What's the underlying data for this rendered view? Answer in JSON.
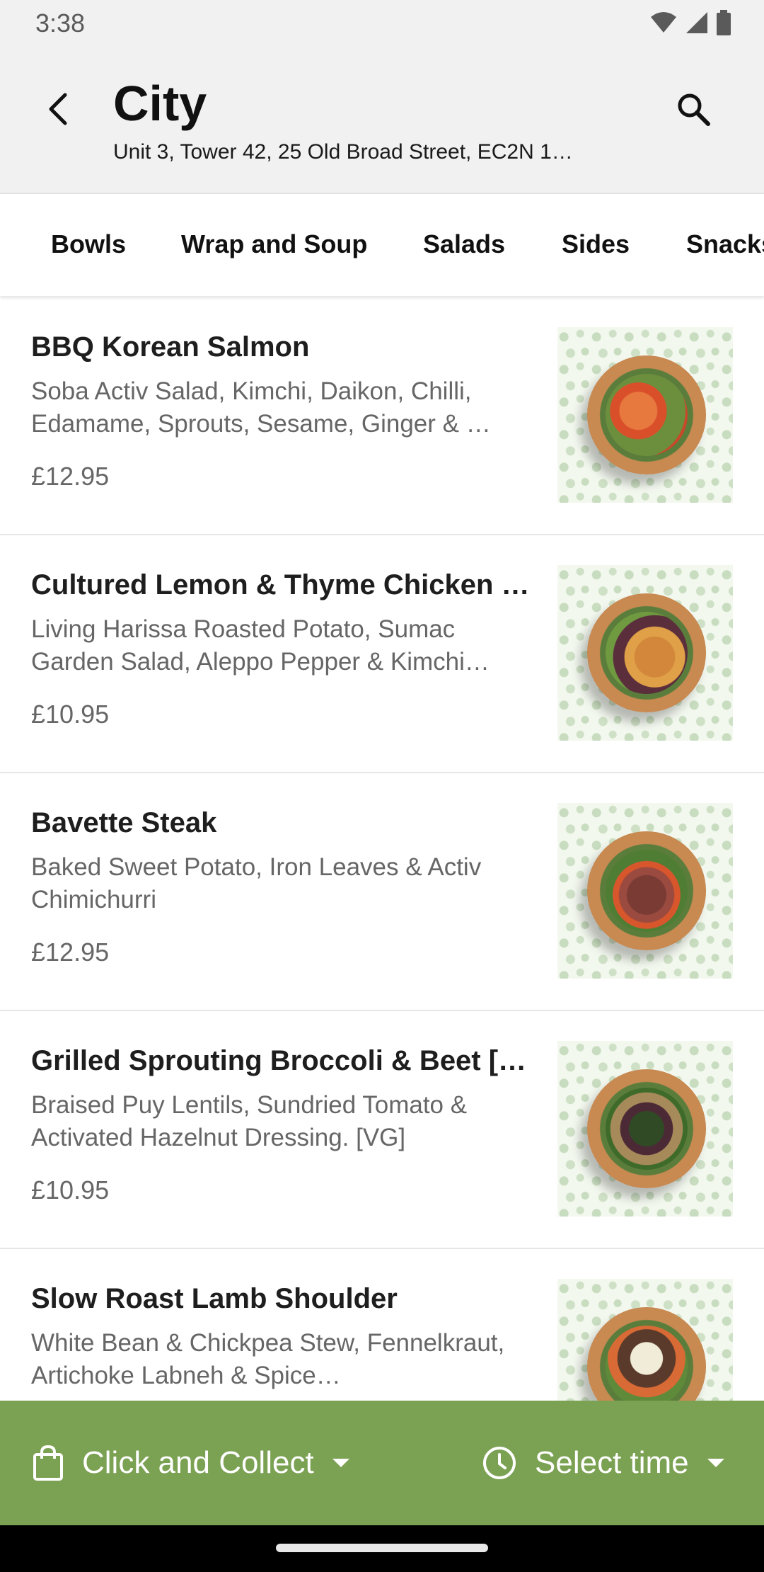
{
  "status": {
    "time": "3:38",
    "icons": [
      "wifi-icon",
      "signal-icon",
      "battery-icon"
    ]
  },
  "header": {
    "title": "City",
    "address": "Unit 3, Tower 42, 25 Old Broad Street, EC2N 1…",
    "back_icon": "back-arrow-icon",
    "search_icon": "search-icon"
  },
  "tabs": [
    {
      "label": "Bowls"
    },
    {
      "label": "Wrap and Soup"
    },
    {
      "label": "Salads"
    },
    {
      "label": "Sides"
    },
    {
      "label": "Snacks"
    }
  ],
  "menu": [
    {
      "name": "BBQ Korean Salmon",
      "description": "Soba Activ Salad, Kimchi, Daikon, Chilli, Edamame, Sprouts,  Sesame, Ginger & …",
      "price": "£12.95"
    },
    {
      "name": "Cultured Lemon & Thyme Chicken …",
      "description": "Living Harissa Roasted Potato, Sumac Garden Salad, Aleppo Pepper & Kimchi…",
      "price": "£10.95"
    },
    {
      "name": "Bavette Steak",
      "description": "Baked Sweet Potato, Iron Leaves & Activ Chimichurri",
      "price": "£12.95"
    },
    {
      "name": "Grilled Sprouting Broccoli & Beet […",
      "description": "Braised Puy Lentils, Sundried Tomato & Activated Hazelnut Dressing. [VG]",
      "price": "£10.95"
    },
    {
      "name": "Slow Roast Lamb Shoulder",
      "description": "White Bean & Chickpea Stew, Fennelkraut, Artichoke Labneh & Spice…",
      "price": ""
    }
  ],
  "bottom_bar": {
    "collect_label": "Click and Collect",
    "time_label": "Select time",
    "collect_icon": "shopping-bag-icon",
    "time_icon": "clock-icon",
    "accent_color": "#7ba153"
  }
}
